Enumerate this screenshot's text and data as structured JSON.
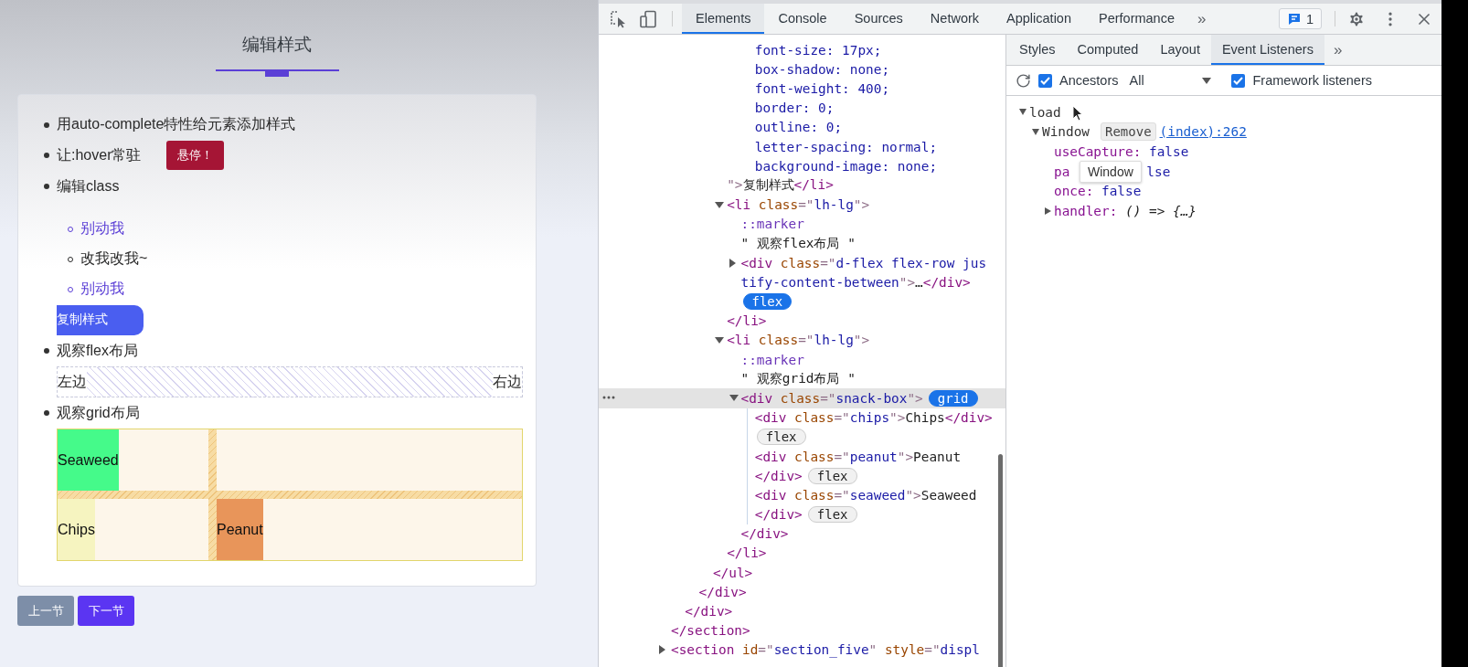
{
  "page": {
    "title": "编辑样式",
    "items": [
      {
        "kind": "bullet",
        "label": "用auto-complete特性给元素添加样式"
      },
      {
        "kind": "hover",
        "label": "让:hover常驻",
        "button": "悬停！"
      },
      {
        "kind": "sublist",
        "label": "编辑class",
        "children": [
          {
            "label": "别动我",
            "color": "#5b3fd6"
          },
          {
            "label": "改我改我~",
            "color": "#2b2b2b"
          },
          {
            "label": "别动我",
            "color": "#5b3fd6"
          }
        ]
      },
      {
        "kind": "copy",
        "label": "复制样式"
      },
      {
        "kind": "flex",
        "label": "观察flex布局",
        "left": "左边",
        "right": "右边"
      },
      {
        "kind": "grid",
        "label": "观察grid布局",
        "rows": [
          [
            {
              "kind": "cell",
              "label": "Seaweed",
              "color": "#45fa8a"
            },
            {
              "kind": "empty"
            }
          ],
          [
            {
              "kind": "cell",
              "label": "Chips",
              "color": "#f6f4c0"
            },
            {
              "kind": "cell",
              "label": "Peanut",
              "color": "#e8955a"
            }
          ]
        ]
      }
    ],
    "nav": [
      {
        "label": "上一节",
        "kind": "secondary"
      },
      {
        "label": "下一节",
        "kind": "primary"
      }
    ]
  },
  "devtools": {
    "tabs": [
      {
        "label": "Elements",
        "selected": true
      },
      {
        "label": "Console",
        "selected": false
      },
      {
        "label": "Sources",
        "selected": false
      },
      {
        "label": "Network",
        "selected": false
      },
      {
        "label": "Application",
        "selected": false
      },
      {
        "label": "Performance",
        "selected": false
      }
    ],
    "more": "»",
    "issues": "1",
    "tree": [
      {
        "children": [
          {
            "children": [
              {
                "children": [
                  {
                    "children": [
                      {
                        "children": [
                          {
                            "children": [
                              {
                                "selected": false,
                                "lines": [
                                  [
                                    {
                                      "kind": "value",
                                      "text": "font-size: 17px;"
                                    }
                                  ],
                                  [
                                    {
                                      "kind": "value",
                                      "text": "box-shadow: none;"
                                    }
                                  ],
                                  [
                                    {
                                      "kind": "value",
                                      "text": "font-weight: 400;"
                                    }
                                  ],
                                  [
                                    {
                                      "kind": "value",
                                      "text": "border: 0;"
                                    }
                                  ],
                                  [
                                    {
                                      "kind": "value",
                                      "text": "outline: 0;"
                                    }
                                  ],
                                  [
                                    {
                                      "kind": "value",
                                      "text": "letter-spacing: normal;"
                                    }
                                  ],
                                  [
                                    {
                                      "kind": "value",
                                      "text": "background-image: none;"
                                    }
                                  ]
                                ]
                              }
                            ]
                          }
                        ]
                      },
                      {
                        "selected": false,
                        "lines": [
                          [
                            {
                              "kind": "punct",
                              "text": "\">"
                            },
                            {
                              "kind": "text",
                              "text": "复制样式"
                            },
                            {
                              "kind": "tag",
                              "text": "</li>"
                            }
                          ]
                        ]
                      },
                      {
                        "selected": false,
                        "expanded": true,
                        "lines": [
                          [
                            {
                              "kind": "tag",
                              "text": "<li"
                            },
                            {
                              "kind": "attr",
                              "text": " class"
                            },
                            {
                              "kind": "punct",
                              "text": "=\""
                            },
                            {
                              "kind": "value",
                              "text": "lh-lg"
                            },
                            {
                              "kind": "punct",
                              "text": "\">"
                            }
                          ]
                        ],
                        "children": [
                          {
                            "selected": false,
                            "lines": [
                              [
                                {
                                  "kind": "pseudo",
                                  "text": "::marker"
                                }
                              ]
                            ]
                          },
                          {
                            "selected": false,
                            "lines": [
                              [
                                {
                                  "kind": "text",
                                  "text": "\" 观察flex布局 \""
                                }
                              ]
                            ]
                          },
                          {
                            "selected": false,
                            "expanded": false,
                            "lines": [
                              [
                                {
                                  "kind": "tag",
                                  "text": "<div"
                                },
                                {
                                  "kind": "attr",
                                  "text": " class"
                                },
                                {
                                  "kind": "punct",
                                  "text": "=\""
                                },
                                {
                                  "kind": "value",
                                  "text": "d-flex flex-row jus"
                                }
                              ],
                              [
                                {
                                  "kind": "value",
                                  "text": "tify-content-between"
                                },
                                {
                                  "kind": "punct",
                                  "text": "\">"
                                },
                                {
                                  "kind": "text",
                                  "text": "…"
                                },
                                {
                                  "kind": "tag",
                                  "text": "</div>"
                                }
                              ],
                              [
                                {
                                  "kind": "badge",
                                  "text": "flex",
                                  "selected": true
                                }
                              ]
                            ]
                          }
                        ]
                      },
                      {
                        "selected": false,
                        "lines": [
                          [
                            {
                              "kind": "tag",
                              "text": "</li>"
                            }
                          ]
                        ]
                      },
                      {
                        "selected": false,
                        "expanded": true,
                        "lines": [
                          [
                            {
                              "kind": "tag",
                              "text": "<li"
                            },
                            {
                              "kind": "attr",
                              "text": " class"
                            },
                            {
                              "kind": "punct",
                              "text": "=\""
                            },
                            {
                              "kind": "value",
                              "text": "lh-lg"
                            },
                            {
                              "kind": "punct",
                              "text": "\">"
                            }
                          ]
                        ],
                        "children": [
                          {
                            "selected": false,
                            "lines": [
                              [
                                {
                                  "kind": "pseudo",
                                  "text": "::marker"
                                }
                              ]
                            ]
                          },
                          {
                            "selected": false,
                            "lines": [
                              [
                                {
                                  "kind": "text",
                                  "text": "\" 观察grid布局 \""
                                }
                              ]
                            ]
                          },
                          {
                            "selected": true,
                            "expanded": true,
                            "lines": [
                              [
                                {
                                  "kind": "tag",
                                  "text": "<div"
                                },
                                {
                                  "kind": "attr",
                                  "text": " class"
                                },
                                {
                                  "kind": "punct",
                                  "text": "=\""
                                },
                                {
                                  "kind": "value",
                                  "text": "snack-box"
                                },
                                {
                                  "kind": "punct",
                                  "text": "\">"
                                },
                                {
                                  "kind": "badge",
                                  "text": "grid",
                                  "selected": true
                                }
                              ]
                            ],
                            "children": [
                              {
                                "selected": false,
                                "lines": [
                                  [
                                    {
                                      "kind": "tag",
                                      "text": "<div"
                                    },
                                    {
                                      "kind": "attr",
                                      "text": " class"
                                    },
                                    {
                                      "kind": "punct",
                                      "text": "=\""
                                    },
                                    {
                                      "kind": "value",
                                      "text": "chips"
                                    },
                                    {
                                      "kind": "punct",
                                      "text": "\">"
                                    },
                                    {
                                      "kind": "text",
                                      "text": "Chips"
                                    },
                                    {
                                      "kind": "tag",
                                      "text": "</div>"
                                    }
                                  ],
                                  [
                                    {
                                      "kind": "badge",
                                      "text": "flex",
                                      "selected": false
                                    }
                                  ]
                                ]
                              },
                              {
                                "selected": false,
                                "lines": [
                                  [
                                    {
                                      "kind": "tag",
                                      "text": "<div"
                                    },
                                    {
                                      "kind": "attr",
                                      "text": " class"
                                    },
                                    {
                                      "kind": "punct",
                                      "text": "=\""
                                    },
                                    {
                                      "kind": "value",
                                      "text": "peanut"
                                    },
                                    {
                                      "kind": "punct",
                                      "text": "\">"
                                    },
                                    {
                                      "kind": "text",
                                      "text": "Peanut"
                                    }
                                  ],
                                  [
                                    {
                                      "kind": "tag",
                                      "text": "</div>"
                                    },
                                    {
                                      "kind": "badge",
                                      "text": "flex",
                                      "selected": false
                                    }
                                  ]
                                ]
                              },
                              {
                                "selected": false,
                                "lines": [
                                  [
                                    {
                                      "kind": "tag",
                                      "text": "<div"
                                    },
                                    {
                                      "kind": "attr",
                                      "text": " class"
                                    },
                                    {
                                      "kind": "punct",
                                      "text": "=\""
                                    },
                                    {
                                      "kind": "value",
                                      "text": "seaweed"
                                    },
                                    {
                                      "kind": "punct",
                                      "text": "\">"
                                    },
                                    {
                                      "kind": "text",
                                      "text": "Seaweed"
                                    }
                                  ],
                                  [
                                    {
                                      "kind": "tag",
                                      "text": "</div>"
                                    },
                                    {
                                      "kind": "badge",
                                      "text": "flex",
                                      "selected": false
                                    }
                                  ]
                                ]
                              }
                            ]
                          },
                          {
                            "selected": false,
                            "lines": [
                              [
                                {
                                  "kind": "tag",
                                  "text": "</div>"
                                }
                              ]
                            ]
                          }
                        ]
                      },
                      {
                        "selected": false,
                        "lines": [
                          [
                            {
                              "kind": "tag",
                              "text": "</li>"
                            }
                          ]
                        ]
                      }
                    ]
                  },
                  {
                    "selected": false,
                    "lines": [
                      [
                        {
                          "kind": "tag",
                          "text": "</ul>"
                        }
                      ]
                    ]
                  }
                ]
              },
              {
                "selected": false,
                "lines": [
                  [
                    {
                      "kind": "tag",
                      "text": "</div>"
                    }
                  ]
                ]
              }
            ]
          },
          {
            "selected": false,
            "lines": [
              [
                {
                  "kind": "tag",
                  "text": "</div>"
                }
              ]
            ]
          }
        ]
      },
      {
        "selected": false,
        "lines": [
          [
            {
              "kind": "tag",
              "text": "</section>"
            }
          ]
        ]
      },
      {
        "selected": false,
        "expanded": false,
        "lines": [
          [
            {
              "kind": "tag",
              "text": "<section"
            },
            {
              "kind": "attr",
              "text": " id"
            },
            {
              "kind": "punct",
              "text": "=\""
            },
            {
              "kind": "value",
              "text": "section_five"
            },
            {
              "kind": "punct",
              "text": "\""
            },
            {
              "kind": "attr",
              "text": " style"
            },
            {
              "kind": "punct",
              "text": "=\""
            },
            {
              "kind": "value",
              "text": "displ"
            }
          ]
        ]
      }
    ],
    "sidebar": {
      "tabs": [
        {
          "label": "Styles",
          "selected": false
        },
        {
          "label": "Computed",
          "selected": false
        },
        {
          "label": "Layout",
          "selected": false
        },
        {
          "label": "Event Listeners",
          "selected": true
        }
      ],
      "more": "»",
      "ancestors": {
        "label": "Ancestors",
        "checked": true
      },
      "filter": "All",
      "framework": {
        "label": "Framework listeners",
        "checked": true
      },
      "events": [
        {
          "name": "load",
          "expanded": true,
          "targets": [
            {
              "name": "Window",
              "expanded": true,
              "remove": "Remove",
              "link": "(index):262",
              "properties": [
                {
                  "key": "useCapture:",
                  "value": "false",
                  "covered": false
                },
                {
                  "key": "pa",
                  "value": "lse",
                  "covered": true
                },
                {
                  "key": "once:",
                  "value": "false",
                  "covered": false
                }
              ],
              "handler": {
                "key": "handler:",
                "value": "() => {…}",
                "expanded": false
              }
            }
          ]
        }
      ],
      "tooltip": "Window"
    }
  }
}
